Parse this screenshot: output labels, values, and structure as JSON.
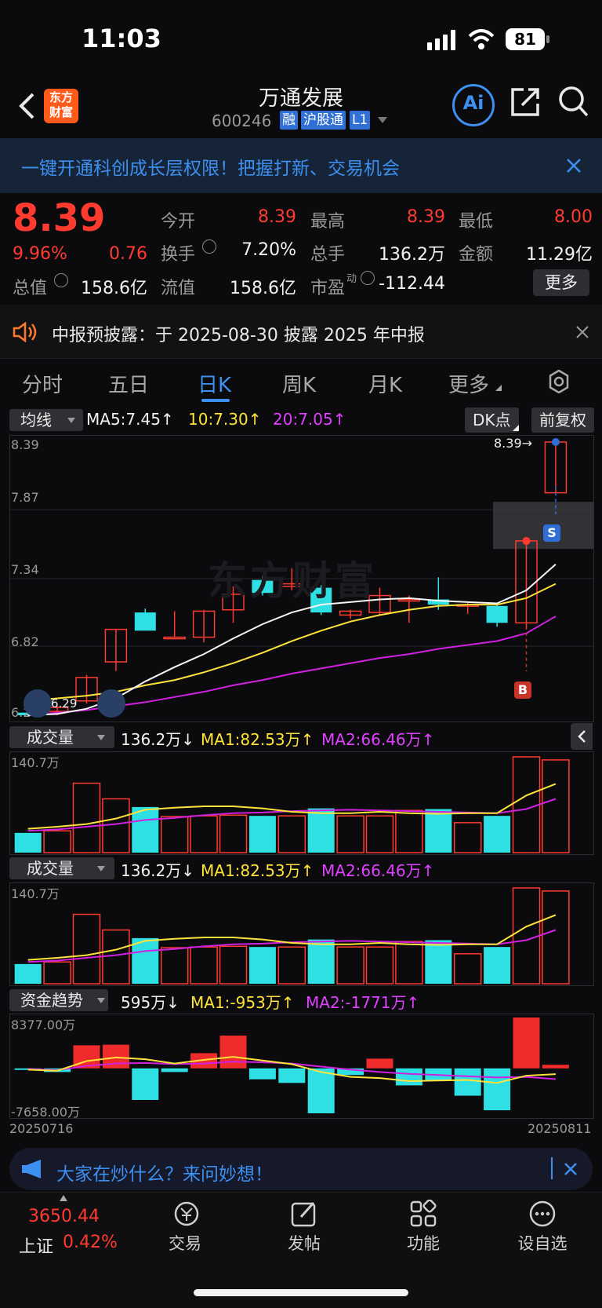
{
  "status_bar": {
    "time": "11:03",
    "battery": "81"
  },
  "nav": {
    "title": "万通发展",
    "code": "600246",
    "badges": [
      "融",
      "沪股通",
      "L1"
    ],
    "logo_text_top": "东方",
    "logo_text_bottom": "财富",
    "ai_label": "Ai"
  },
  "banner": {
    "text": "一键开通科创成长层权限！把握打新、交易机会"
  },
  "quote": {
    "price": "8.39",
    "change_pct": "9.96%",
    "change": "0.76",
    "open_label": "今开",
    "open": "8.39",
    "high_label": "最高",
    "high": "8.39",
    "low_label": "最低",
    "low": "8.00",
    "turnover_label": "换手",
    "turnover": "7.20%",
    "volume_label": "总手",
    "volume": "136.2万",
    "amount_label": "金额",
    "amount": "11.29亿",
    "mktcap_label": "总值",
    "mktcap": "158.6亿",
    "float_label": "流值",
    "float": "158.6亿",
    "pe_label": "市盈",
    "pe_sup": "动",
    "pe": "-112.44",
    "more_label": "更多"
  },
  "notice": {
    "text": "中报预披露：于 2025-08-30 披露 2025 年中报"
  },
  "tabs": [
    "分时",
    "五日",
    "日K",
    "周K",
    "月K",
    "更多"
  ],
  "active_tab": "日K",
  "kline": {
    "indicator_label": "均线",
    "ma5": "MA5:7.45↑",
    "ma10": "10:7.30↑",
    "ma20": "20:7.05↑",
    "dk_label": "DK点",
    "adjust_label": "前复权",
    "y_labels": [
      "8.39",
      "7.87",
      "7.34",
      "6.82",
      "6.29"
    ],
    "last_price_tag": "8.39→",
    "low_tag": "6.29",
    "sell_marker": "S",
    "buy_marker": "B",
    "watermark": "东方财富"
  },
  "volume1": {
    "label": "成交量",
    "value": "136.2万↓",
    "ma1": "MA1:82.53万↑",
    "ma2": "MA2:66.46万↑",
    "max_label": "140.7万"
  },
  "volume2": {
    "label": "成交量",
    "value": "136.2万↓",
    "ma1": "MA1:82.53万↑",
    "ma2": "MA2:66.46万↑",
    "max_label": "140.7万"
  },
  "fund": {
    "label": "资金趋势",
    "value": "595万↓",
    "ma1": "MA1:-953万↑",
    "ma2": "MA2:-1771万↑",
    "max_label": "8377.00万",
    "min_label": "-7658.00万",
    "date_start": "20250716",
    "date_end": "20250811"
  },
  "chart_data": {
    "type": "candlestick",
    "dates_range": [
      "20250716",
      "20250811"
    ],
    "ohlc": [
      [
        6.31,
        6.33,
        6.28,
        6.29
      ],
      [
        6.32,
        6.36,
        6.29,
        6.35
      ],
      [
        6.4,
        6.6,
        6.38,
        6.58
      ],
      [
        6.7,
        6.95,
        6.63,
        6.95
      ],
      [
        7.08,
        7.11,
        6.95,
        6.94
      ],
      [
        6.89,
        7.09,
        6.89,
        6.89
      ],
      [
        6.89,
        7.1,
        6.85,
        7.09
      ],
      [
        7.1,
        7.28,
        7.0,
        7.22
      ],
      [
        7.33,
        7.36,
        7.21,
        7.23
      ],
      [
        7.28,
        7.42,
        7.25,
        7.3
      ],
      [
        7.27,
        7.29,
        7.06,
        7.08
      ],
      [
        7.06,
        7.1,
        7.03,
        7.09
      ],
      [
        7.08,
        7.27,
        7.06,
        7.21
      ],
      [
        7.18,
        7.21,
        7.0,
        7.18
      ],
      [
        7.18,
        7.35,
        7.1,
        7.14
      ],
      [
        7.13,
        7.16,
        7.07,
        7.14
      ],
      [
        7.13,
        7.14,
        6.97,
        7.0
      ],
      [
        7.0,
        7.63,
        6.95,
        7.63
      ],
      [
        8.0,
        8.39,
        8.0,
        8.39
      ]
    ],
    "ma5": [
      6.29,
      6.3,
      6.34,
      6.42,
      6.55,
      6.66,
      6.76,
      6.88,
      6.99,
      7.08,
      7.14,
      7.16,
      7.18,
      7.19,
      7.17,
      7.16,
      7.15,
      7.25,
      7.45
    ],
    "ma10": [
      6.4,
      6.42,
      6.44,
      6.47,
      6.52,
      6.56,
      6.62,
      6.69,
      6.77,
      6.86,
      6.94,
      7.01,
      7.06,
      7.1,
      7.13,
      7.14,
      7.14,
      7.19,
      7.3
    ],
    "ma20": [
      6.29,
      6.31,
      6.33,
      6.36,
      6.39,
      6.43,
      6.47,
      6.52,
      6.56,
      6.61,
      6.65,
      6.69,
      6.73,
      6.76,
      6.8,
      6.83,
      6.86,
      6.92,
      7.05
    ],
    "volume": [
      29,
      32,
      102,
      79,
      67,
      53,
      54,
      55,
      54,
      54,
      65,
      54,
      54,
      62,
      64,
      44,
      54,
      140.7,
      136.2
    ],
    "volume_ma1": [
      35,
      38,
      42,
      50,
      63,
      66,
      68,
      68,
      65,
      60,
      58,
      58,
      60,
      58,
      57,
      58,
      58,
      84,
      101
    ],
    "volume_ma2": [
      32,
      34,
      38,
      42,
      48,
      51,
      55,
      58,
      59,
      61,
      62,
      63,
      62,
      61,
      60,
      59,
      58,
      64,
      79
    ],
    "fund_flow": [
      -200,
      -600,
      3800,
      3900,
      -5200,
      -600,
      2500,
      5400,
      -1800,
      -2400,
      -7400,
      -1100,
      1600,
      -2800,
      -1900,
      -4500,
      -6900,
      8377,
      595
    ],
    "fund_ma1": [
      -200,
      -400,
      1200,
      1800,
      1500,
      800,
      1400,
      1900,
      1300,
      700,
      -600,
      -1400,
      -1600,
      -2100,
      -2000,
      -1900,
      -2400,
      -1200,
      -953
    ],
    "fund_ma2": [
      -100,
      -300,
      400,
      800,
      900,
      700,
      800,
      1100,
      1000,
      800,
      300,
      -200,
      -600,
      -900,
      -1100,
      -1300,
      -1500,
      -1400,
      -1771
    ],
    "ylim": [
      6.29,
      8.39
    ]
  }
}
